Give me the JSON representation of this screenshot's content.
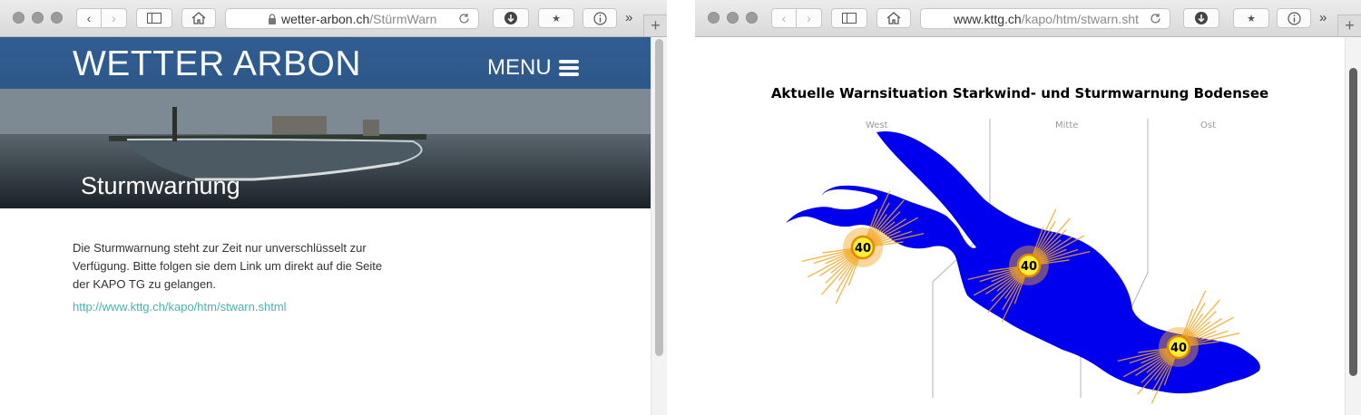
{
  "left_window": {
    "address": {
      "host": "wetter-arbon.ch",
      "path": "/StürmWarn"
    },
    "page": {
      "site_title": "WETTER ARBON",
      "menu_label": "MENU",
      "hero_caption": "Sturmwarnung",
      "body_text": "Die Sturmwarnung steht zur Zeit nur unverschlüsselt zur Verfügung. Bitte folgen sie dem Link um direkt auf die Seite der KAPO TG zu gelangen.",
      "link_text": "http://www.kttg.ch/kapo/htm/stwarn.shtml"
    }
  },
  "right_window": {
    "address": {
      "host": "www.kttg.ch",
      "path": "/kapo/htm/stwarn.sht"
    },
    "page": {
      "title": "Aktuelle Warnsituation Starkwind- und Sturmwarnung Bodensee",
      "regions": [
        "West",
        "Mitte",
        "Ost"
      ],
      "warnings": [
        {
          "region": "West",
          "value": "40"
        },
        {
          "region": "Mitte",
          "value": "40"
        },
        {
          "region": "Ost",
          "value": "40"
        }
      ],
      "colors": {
        "lake": "#0000ee",
        "burst": "#f5a623",
        "badge_fill": "#ffee33"
      }
    }
  },
  "toolbar": {
    "overflow_label": "»",
    "new_tab_label": "+"
  }
}
